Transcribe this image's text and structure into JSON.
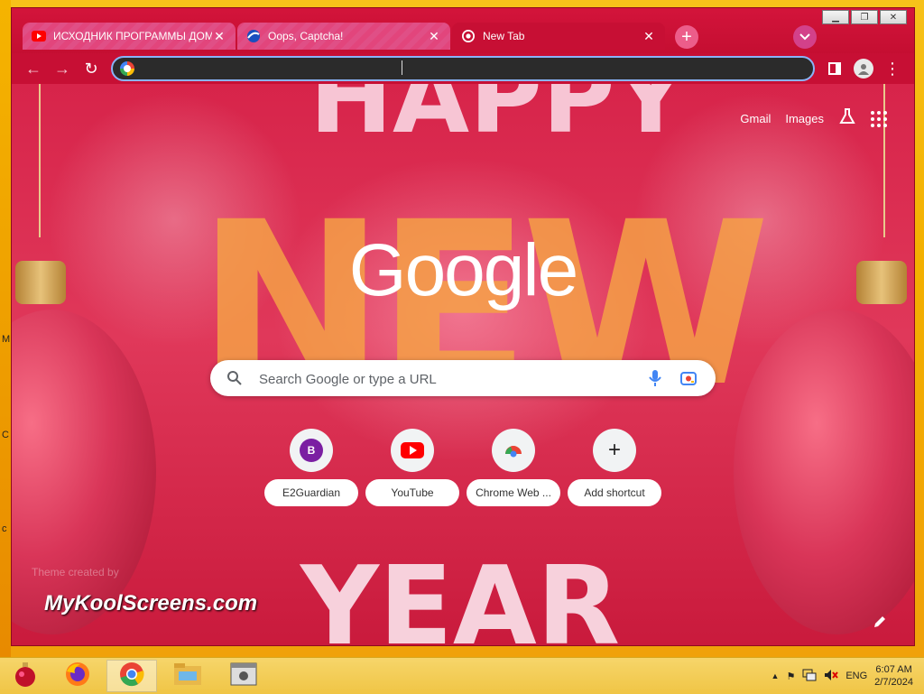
{
  "window": {
    "controls": [
      "minimize",
      "maximize",
      "close"
    ]
  },
  "tabs": [
    {
      "title": "ИСХОДНИК ПРОГРАММЫ ДОМ",
      "favicon": "youtube-icon",
      "active": false
    },
    {
      "title": "Oops, Captcha!",
      "favicon": "captcha-icon",
      "active": false
    },
    {
      "title": "New Tab",
      "favicon": "chrome-icon",
      "active": true
    }
  ],
  "toolbar": {
    "omnibox_value": "",
    "icons": [
      "back-icon",
      "forward-icon",
      "reload-icon",
      "side-panel-icon",
      "profile-icon",
      "menu-icon"
    ]
  },
  "ntp": {
    "header_links": {
      "gmail": "Gmail",
      "images": "Images"
    },
    "logo": "Google",
    "search_placeholder": "Search Google or type a URL",
    "shortcuts": [
      {
        "label": "E2Guardian",
        "icon_letter": "B"
      },
      {
        "label": "YouTube"
      },
      {
        "label": "Chrome Web ..."
      },
      {
        "label": "Add shortcut"
      }
    ],
    "theme_credit": "Theme created by",
    "watermark": "MyKoolScreens.com",
    "background_text": {
      "top": "HAPPY",
      "middle": "NEW",
      "bottom": "YEAR"
    }
  },
  "taskbar": {
    "language": "ENG",
    "time": "6:07 AM",
    "date": "2/7/2024"
  },
  "colors": {
    "theme_red": "#c70f34",
    "tab_pink": "#e2457c",
    "taskbar": "#f0c545"
  }
}
